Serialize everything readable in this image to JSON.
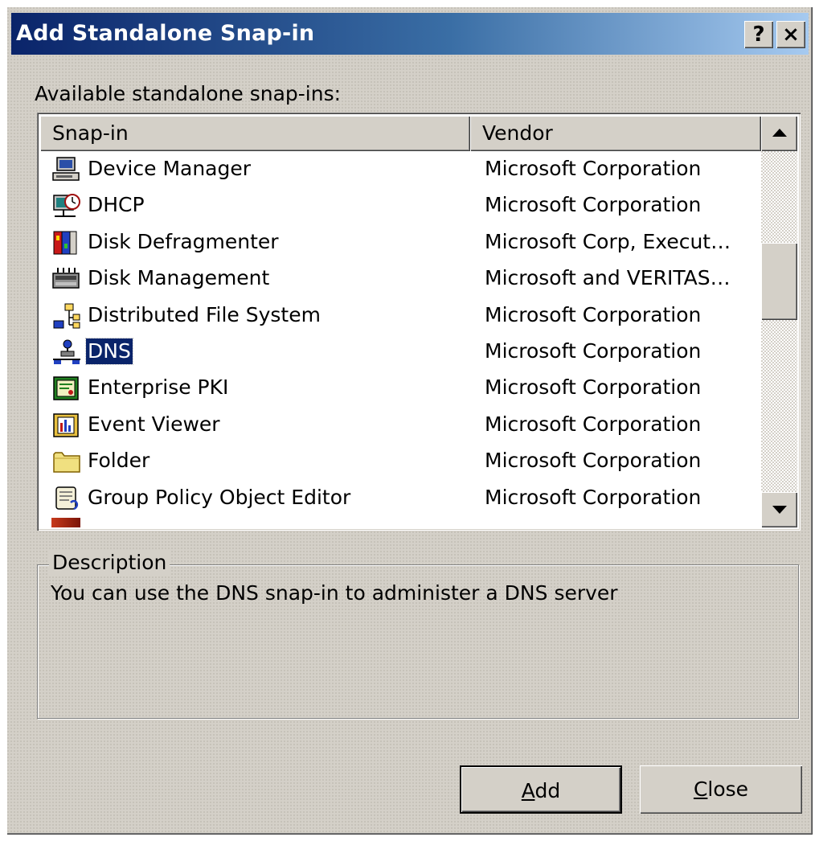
{
  "window": {
    "title": "Add Standalone Snap-in",
    "help_button": "?",
    "close_button": "×"
  },
  "available_label": "Available standalone snap-ins:",
  "list": {
    "columns": [
      "Snap-in",
      "Vendor"
    ],
    "rows": [
      {
        "name": "Device Manager",
        "vendor": "Microsoft Corporation",
        "icon": "device-manager-icon"
      },
      {
        "name": "DHCP",
        "vendor": "Microsoft Corporation",
        "icon": "dhcp-icon"
      },
      {
        "name": "Disk Defragmenter",
        "vendor": "Microsoft Corp, Execut…",
        "icon": "disk-defragmenter-icon"
      },
      {
        "name": "Disk Management",
        "vendor": "Microsoft and VERITAS…",
        "icon": "disk-management-icon"
      },
      {
        "name": "Distributed File System",
        "vendor": "Microsoft Corporation",
        "icon": "distributed-file-system-icon"
      },
      {
        "name": "DNS",
        "vendor": "Microsoft Corporation",
        "icon": "dns-icon",
        "selected": true
      },
      {
        "name": "Enterprise PKI",
        "vendor": "Microsoft Corporation",
        "icon": "enterprise-pki-icon"
      },
      {
        "name": "Event Viewer",
        "vendor": "Microsoft Corporation",
        "icon": "event-viewer-icon"
      },
      {
        "name": "Folder",
        "vendor": "Microsoft Corporation",
        "icon": "folder-icon"
      },
      {
        "name": "Group Policy Object Editor",
        "vendor": "Microsoft Corporation",
        "icon": "group-policy-icon"
      }
    ]
  },
  "description": {
    "legend": "Description",
    "text": "You can use the DNS snap-in to administer a DNS server"
  },
  "buttons": {
    "add": {
      "accel": "A",
      "rest": "dd"
    },
    "close": {
      "accel": "C",
      "rest": "lose"
    }
  },
  "colors": {
    "title_gradient_start": "#0a246a",
    "title_gradient_end": "#a6caf0",
    "selection": "#0a246a",
    "dialog_face": "#d4d0c8"
  }
}
